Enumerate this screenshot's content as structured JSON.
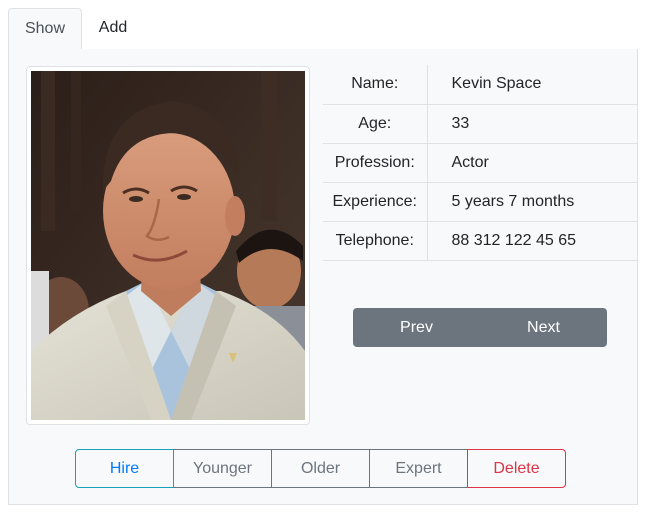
{
  "tabs": [
    {
      "label": "Show",
      "active": true
    },
    {
      "label": "Add",
      "active": false
    }
  ],
  "profile": {
    "photo_alt": "Kevin Space",
    "fields": [
      {
        "label": "Name:",
        "value": "Kevin Space"
      },
      {
        "label": "Age:",
        "value": "33"
      },
      {
        "label": "Profession:",
        "value": "Actor"
      },
      {
        "label": "Experience:",
        "value": "5 years 7 months"
      },
      {
        "label": "Telephone:",
        "value": "88 312 122 45 65"
      }
    ]
  },
  "navigation": {
    "prev_label": "Prev",
    "next_label": "Next"
  },
  "actions": {
    "hire_label": "Hire",
    "younger_label": "Younger",
    "older_label": "Older",
    "expert_label": "Expert",
    "delete_label": "Delete"
  },
  "colors": {
    "panel_bg": "#f8f9fa",
    "border": "#dee2e6",
    "secondary": "#6c757d",
    "hire": "#007bff",
    "delete": "#dc3545"
  }
}
